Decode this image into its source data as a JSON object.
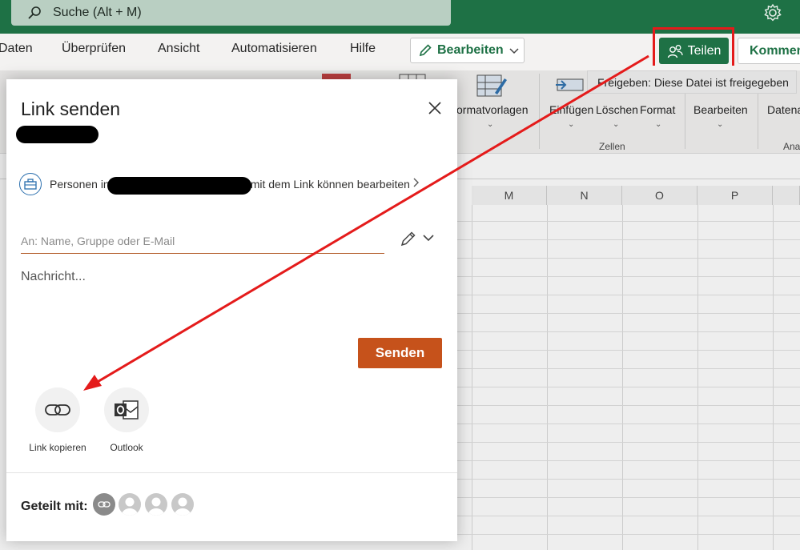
{
  "titlebar": {
    "search_placeholder": "Suche (Alt + M)"
  },
  "menu": {
    "items": [
      "Daten",
      "Überprüfen",
      "Ansicht",
      "Automatisieren",
      "Hilfe"
    ],
    "edit_label": "Bearbeiten",
    "share_label": "Teilen",
    "comments_label": "Kommentare"
  },
  "tooltip": "Freigeben: Diese Datei ist freigegeben",
  "ribbon": {
    "styles_label": "ormatvorlagen",
    "cells_buttons": [
      "Einfügen",
      "Löschen",
      "Format"
    ],
    "cells_group": "Zellen",
    "editing_label": "Bearbeiten",
    "data_label": "Datena",
    "analysis_group": "Ana"
  },
  "grid": {
    "columns": [
      "M",
      "N",
      "O",
      "P"
    ]
  },
  "dialog": {
    "title": "Link senden",
    "permission_prefix": "Personen in",
    "permission_suffix": "mit dem Link können bearbeiten",
    "to_placeholder": "An: Name, Gruppe oder E-Mail",
    "message_placeholder": "Nachricht...",
    "send_label": "Senden",
    "options": [
      {
        "label": "Link kopieren",
        "icon": "link-icon"
      },
      {
        "label": "Outlook",
        "icon": "outlook-icon"
      }
    ],
    "shared_with_label": "Geteilt mit:"
  },
  "colors": {
    "excel_green": "#1e7145",
    "send_orange": "#c6521b",
    "annotation_red": "#e41b1b"
  }
}
